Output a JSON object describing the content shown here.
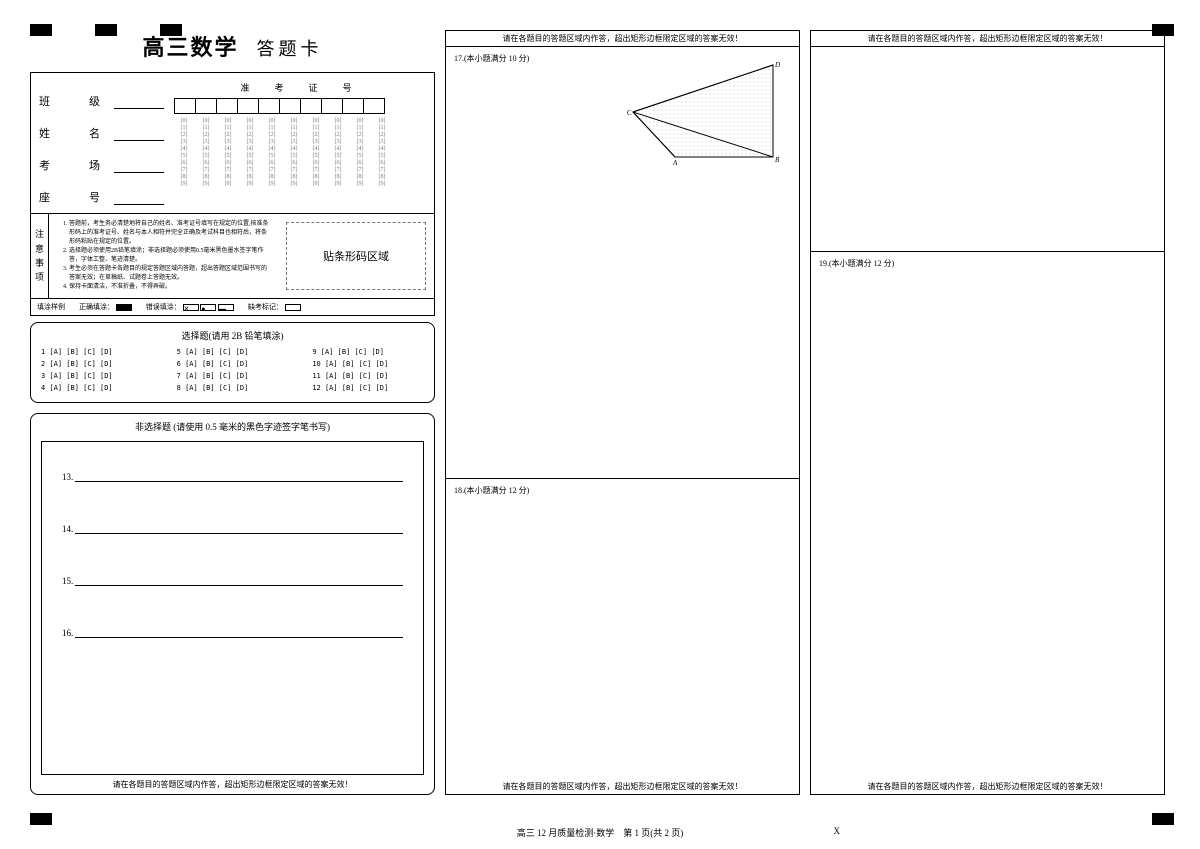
{
  "title": {
    "main": "高三数学",
    "sub": "答题卡"
  },
  "info": {
    "class_label": "班　级",
    "name_label": "姓　名",
    "room_label": "考　场",
    "seat_label": "座　号",
    "exam_no_title": "准　考　证　号"
  },
  "notice": {
    "heading": [
      "注",
      "意",
      "事",
      "项"
    ],
    "items": [
      "答题前，考生务必清楚地将自己的姓名、准考证号填写在规定的位置,核准条形码上的准考证号、姓名与本人相符并完全正确及考试科目也相符后，将条形码粘贴在规定的位置。",
      "选择题必须使用2B铅笔填涂；非选择题必须使用0.5毫米黑色墨水签字笔作答，字体工整、笔迹清楚。",
      "考生必须在答题卡各题目的规定答题区域内答题，超出答题区域范围书写的答案无效；在草稿纸、试题卷上答题无效。",
      "保持卡面清洁，不准折叠，不得弄破。"
    ],
    "barcode_label": "贴条形码区域"
  },
  "fill_example": {
    "label": "填涂样例",
    "correct": "正确填涂：",
    "wrong": "错误填涂：",
    "missing": "缺考标记："
  },
  "mcq": {
    "title": "选择题(请用 2B 铅笔填涂)",
    "rows": [
      "1  [A] [B] [C] [D]",
      "5  [A] [B] [C] [D]",
      "9  [A] [B] [C] [D]",
      "2  [A] [B] [C] [D]",
      "6  [A] [B] [C] [D]",
      "10 [A] [B] [C] [D]",
      "3  [A] [B] [C] [D]",
      "7  [A] [B] [C] [D]",
      "11 [A] [B] [C] [D]",
      "4  [A] [B] [C] [D]",
      "8  [A] [B] [C] [D]",
      "12 [A] [B] [C] [D]"
    ]
  },
  "free": {
    "title": "非选择题 (请使用 0.5 毫米的黑色字迹签字笔书写)",
    "q13": "13.",
    "q14": "14.",
    "q15": "15.",
    "q16": "16."
  },
  "warning": "请在各题目的答题区域内作答，超出矩形边框限定区域的答案无效！",
  "questions": {
    "q17": "17.(本小题满分 10 分)",
    "q18": "18.(本小题满分 12 分)",
    "q19": "19.(本小题满分 12 分)"
  },
  "triangle_labels": {
    "A": "A",
    "B": "B",
    "C": "C",
    "D": "D"
  },
  "footer": {
    "text": "高三 12 月质量检测·数学　第 1 页(共 2 页)",
    "x": "X"
  }
}
